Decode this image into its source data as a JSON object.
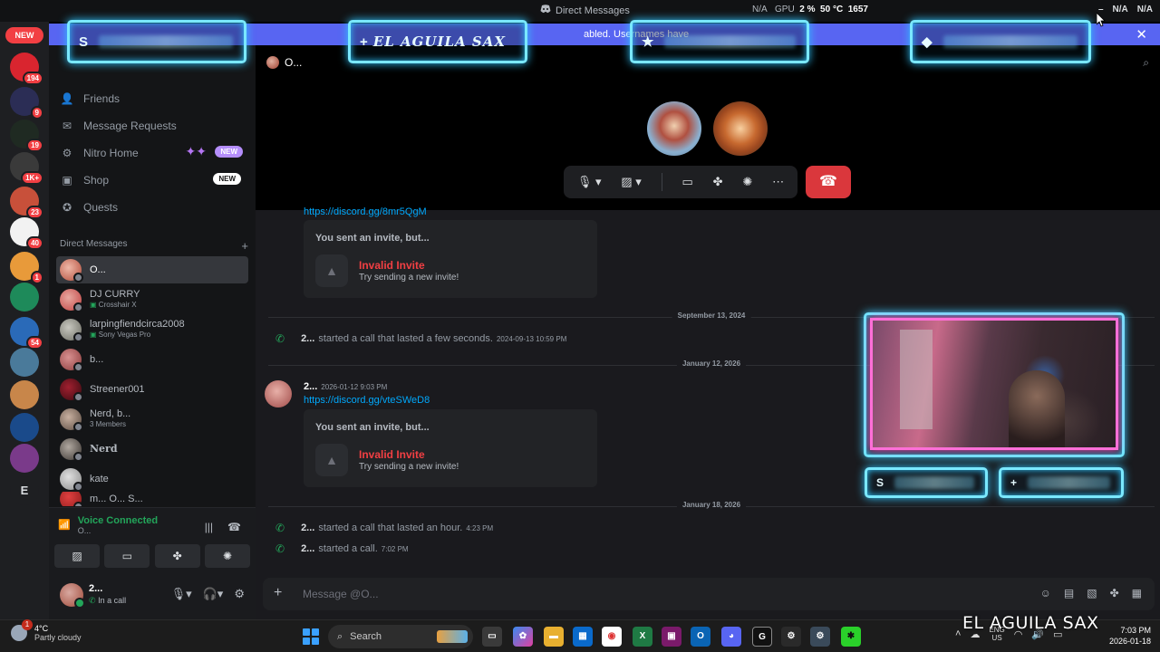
{
  "window": {
    "title": "Direct Messages",
    "stats": {
      "cpu": "N/A",
      "gpu_label": "GPU",
      "gpu_usage": "2 %",
      "gpu_temp": "50 °C",
      "gpu_clock": "1657",
      "extra": "N/A"
    },
    "controls": [
      "N/A",
      "N/A"
    ]
  },
  "banner": {
    "text": "abled. Usernames have"
  },
  "servers": {
    "new_label": "NEW",
    "badges": [
      "194",
      "9",
      "19",
      "1K+",
      "23",
      "40",
      "1",
      "54"
    ],
    "letter": "E"
  },
  "nav": {
    "friends": "Friends",
    "message_requests": "Message Requests",
    "nitro_home": "Nitro Home",
    "nitro_badge": "NEW",
    "shop": "Shop",
    "shop_badge": "NEW",
    "quests": "Quests"
  },
  "dm_section": {
    "header": "Direct Messages",
    "add": "+",
    "items": [
      {
        "name": "O...",
        "sub": ""
      },
      {
        "name": "DJ CURRY",
        "sub": "Crosshair X"
      },
      {
        "name": "larpingfiendcirca2008",
        "sub": "Sony Vegas Pro"
      },
      {
        "name": "b...",
        "sub": ""
      },
      {
        "name": "Streener001",
        "sub": ""
      },
      {
        "name": "Nerd, b...",
        "sub": "3 Members"
      },
      {
        "name": "Nerd",
        "sub": ""
      },
      {
        "name": "kate",
        "sub": ""
      },
      {
        "name": "m... O... S...",
        "sub": ""
      }
    ]
  },
  "voice": {
    "status": "Voice Connected",
    "channel": "O..."
  },
  "user": {
    "name": "2...",
    "status": "In a call"
  },
  "channel": {
    "name": "O..."
  },
  "call": {
    "hangup_icon": "phone-hangup-icon"
  },
  "messages": {
    "top_link": "https://discord.gg/8mr5QgM",
    "invite1": {
      "header": "You sent an invite, but...",
      "title": "Invalid Invite",
      "sub": "Try sending a new invite!"
    },
    "date1": "September 13, 2024",
    "call1": {
      "who": "2...",
      "text": "started a call that lasted a few seconds.",
      "ts": "2024-09-13 10:59 PM"
    },
    "date2": "January 12, 2026",
    "post": {
      "author": "2...",
      "ts": "2026-01-12 9:03 PM",
      "link": "https://discord.gg/vteSWeD8"
    },
    "invite2": {
      "header": "You sent an invite, but...",
      "title": "Invalid Invite",
      "sub": "Try sending a new invite!"
    },
    "date3": "January 18, 2026",
    "call2": {
      "who": "2...",
      "text": "started a call that lasted an hour.",
      "ts": "4:23 PM"
    },
    "call3": {
      "who": "2...",
      "text": "started a call.",
      "ts": "7:02 PM"
    }
  },
  "composer": {
    "placeholder": "Message @O..."
  },
  "overlay": {
    "tile1_symbol": "S",
    "tile2_symbol": "+",
    "tile2_label": "EL AGUILA SAX",
    "tile3_symbol": "★",
    "tile4_symbol": "◆",
    "cam_tile1_symbol": "S",
    "cam_tile2_symbol": "+",
    "watermark": "EL AGUILA SAX"
  },
  "taskbar": {
    "weather_temp": "4°C",
    "weather_desc": "Partly cloudy",
    "weather_badge": "1",
    "search": "Search",
    "lang1": "ENG",
    "lang2": "US",
    "time": "7:03 PM",
    "date": "2026-01-18"
  },
  "colors": {
    "brand": "#5865f2",
    "danger": "#da373c",
    "online": "#23a55a",
    "link": "#00a8fc",
    "neon_cyan": "#7ae8ff",
    "neon_pink": "#ff6fd8"
  }
}
